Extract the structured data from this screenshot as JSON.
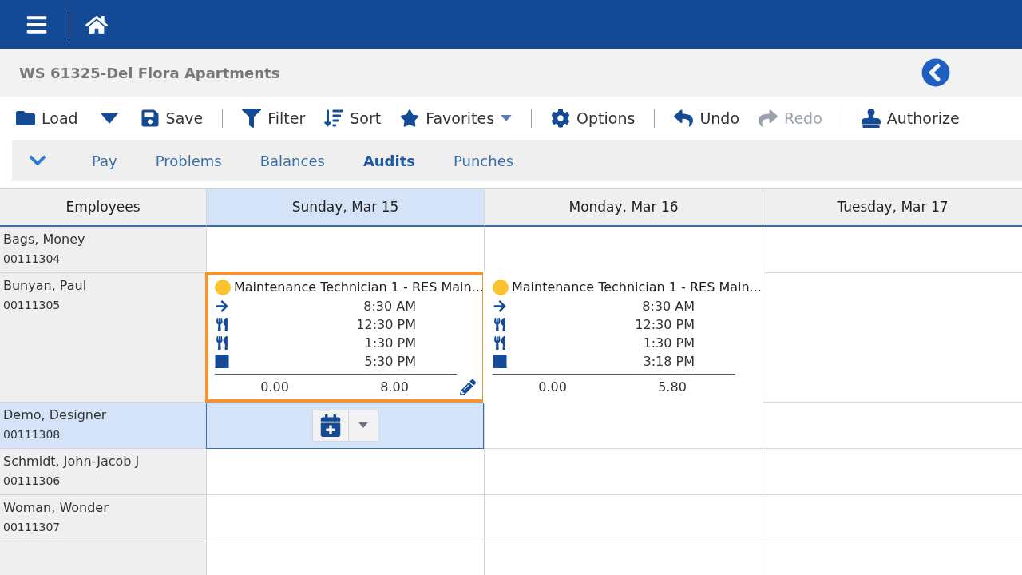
{
  "header": {
    "title": "WS 61325-Del Flora Apartments"
  },
  "toolbar": [
    {
      "kind": "folder",
      "label": "Load",
      "disabled": false
    },
    {
      "kind": "caret",
      "disabled": false
    },
    {
      "kind": "save",
      "label": "Save",
      "disabled": false
    },
    {
      "kind": "separator"
    },
    {
      "kind": "filter",
      "label": "Filter",
      "disabled": false
    },
    {
      "kind": "sort",
      "label": "Sort",
      "disabled": false
    },
    {
      "kind": "star",
      "label": "Favorites",
      "disabled": false,
      "menu": true
    },
    {
      "kind": "separator"
    },
    {
      "kind": "gear",
      "label": "Options",
      "disabled": false
    },
    {
      "kind": "separator"
    },
    {
      "kind": "undo",
      "label": "Undo",
      "disabled": false
    },
    {
      "kind": "redo",
      "label": "Redo",
      "disabled": true
    },
    {
      "kind": "separator"
    },
    {
      "kind": "stamp",
      "label": "Authorize",
      "disabled": false
    }
  ],
  "tabs": [
    {
      "label": "Pay",
      "selected": false
    },
    {
      "label": "Problems",
      "selected": false
    },
    {
      "label": "Balances",
      "selected": false
    },
    {
      "label": "Audits",
      "selected": true
    },
    {
      "label": "Punches",
      "selected": false
    }
  ],
  "grid": {
    "employees_heading": "Employees",
    "days": [
      {
        "label": "Sunday, Mar 15",
        "selected": true
      },
      {
        "label": "Monday, Mar 16",
        "selected": false
      },
      {
        "label": "Tuesday, Mar 17",
        "selected": false
      }
    ],
    "rows": [
      {
        "name": "Bags, Money",
        "id": "00111304",
        "selected": false,
        "cells": [
          {
            "selected": false
          },
          {
            "selected": false
          },
          {
            "selected": false
          }
        ]
      },
      {
        "name": "Bunyan, Paul",
        "id": "00111305",
        "selected": false,
        "cells": [
          {
            "selected": false,
            "shift": {
              "title": "Maintenance Technician 1 - RES Main...",
              "color": "#f9c22e",
              "highlighted": true,
              "punches": [
                {
                  "kind": "in",
                  "time": "8:30 AM"
                },
                {
                  "kind": "meal",
                  "time": "12:30 PM"
                },
                {
                  "kind": "meal",
                  "time": "1:30 PM"
                },
                {
                  "kind": "out",
                  "time": "5:30 PM"
                }
              ],
              "totals": [
                "0.00",
                "8.00"
              ]
            }
          },
          {
            "selected": false,
            "shift": {
              "title": "Maintenance Technician 1 - RES Main...",
              "color": "#f9c22e",
              "highlighted": false,
              "punches": [
                {
                  "kind": "in",
                  "time": "8:30 AM"
                },
                {
                  "kind": "meal",
                  "time": "12:30 PM"
                },
                {
                  "kind": "meal",
                  "time": "1:30 PM"
                },
                {
                  "kind": "out",
                  "time": "3:18 PM"
                }
              ],
              "totals": [
                "0.00",
                "5.80"
              ]
            }
          },
          {
            "selected": false
          }
        ]
      },
      {
        "name": "Demo, Designer",
        "id": "00111308",
        "selected": true,
        "cells": [
          {
            "selected": true
          },
          {
            "selected": false
          },
          {
            "selected": false
          }
        ]
      },
      {
        "name": "Schmidt, John-Jacob J",
        "id": "00111306",
        "selected": false,
        "cells": [
          {
            "selected": false
          },
          {
            "selected": false
          },
          {
            "selected": false
          }
        ]
      },
      {
        "name": "Woman, Wonder",
        "id": "00111307",
        "selected": false,
        "cells": [
          {
            "selected": false
          },
          {
            "selected": false
          },
          {
            "selected": false
          }
        ]
      }
    ]
  }
}
